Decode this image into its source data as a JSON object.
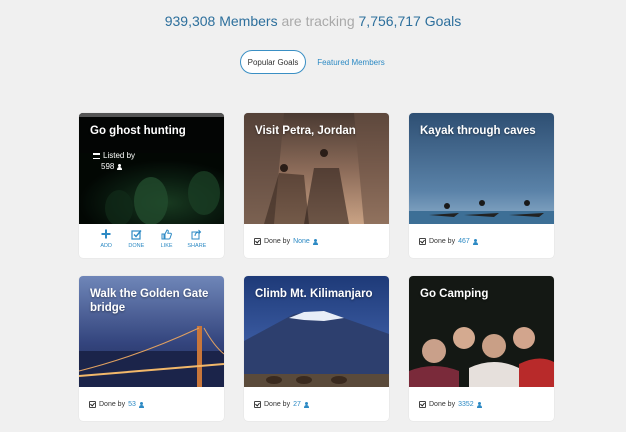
{
  "stats": {
    "members": "939,308",
    "members_label": "Members",
    "connector": "are tracking",
    "goals": "7,756,717",
    "goals_label": "Goals"
  },
  "tabs": {
    "popular": "Popular Goals",
    "featured": "Featured Members"
  },
  "cards": [
    {
      "title": "Go ghost hunting",
      "listed_label": "Listed by",
      "listed_count": "598",
      "actions": [
        "ADD",
        "DONE",
        "LIKE",
        "SHARE"
      ]
    },
    {
      "title": "Visit Petra, Jordan",
      "done_label": "Done by",
      "done_count": "None"
    },
    {
      "title": "Kayak through caves",
      "done_label": "Done by",
      "done_count": "467"
    },
    {
      "title": "Walk the Golden Gate bridge",
      "done_label": "Done by",
      "done_count": "53"
    },
    {
      "title": "Climb Mt. Kilimanjaro",
      "done_label": "Done by",
      "done_count": "27"
    },
    {
      "title": "Go Camping",
      "done_label": "Done by",
      "done_count": "3352"
    }
  ],
  "colors": {
    "accent": "#2d8ac4",
    "stat_number": "#2d6f9c",
    "muted": "#a9a9a9",
    "background": "#f0f0f0"
  }
}
